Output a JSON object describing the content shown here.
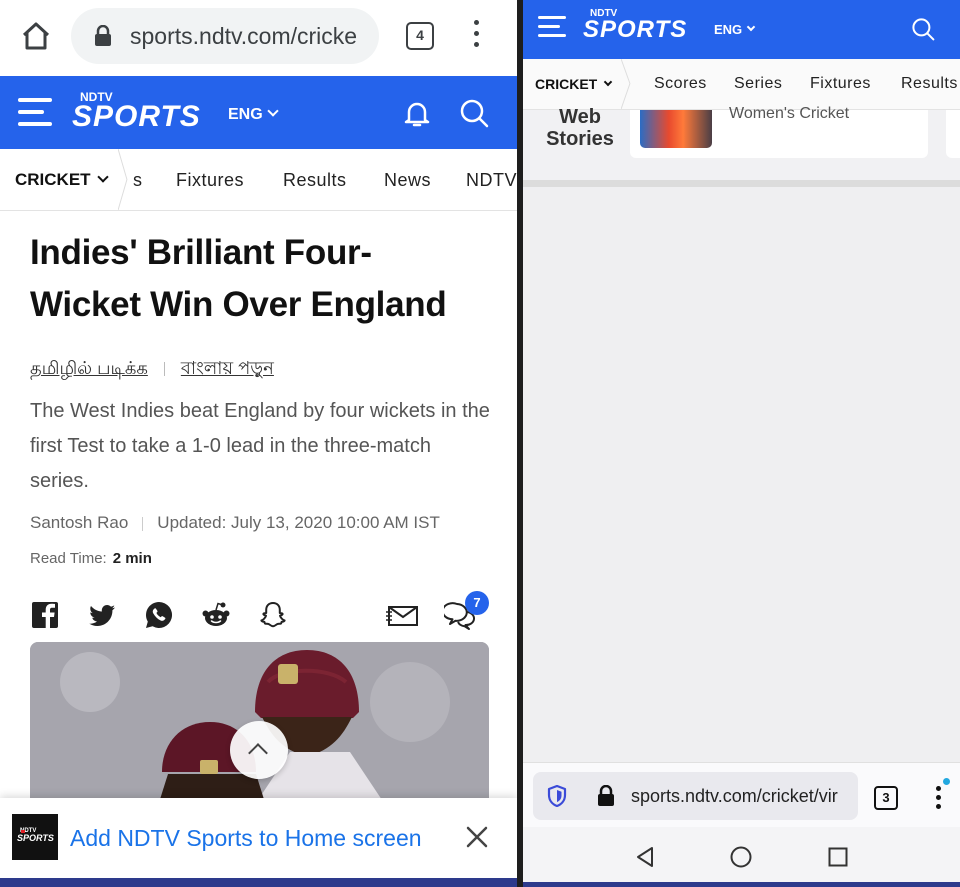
{
  "left": {
    "browser": {
      "url": "sports.ndtv.com/cricke",
      "tab_count": "4"
    },
    "header": {
      "logo_ndtv": "NDTV",
      "logo_sports": "SPORTS",
      "language": "ENG"
    },
    "subnav": {
      "category": "CRICKET",
      "items": [
        "s",
        "Fixtures",
        "Results",
        "News",
        "NDTV"
      ]
    },
    "article": {
      "headline_line1": "Indies' Brilliant Four-",
      "headline_line2": "Wicket Win Over England",
      "lang_tamil": "தமிழில் படிக்க",
      "lang_bengali": "বাংলায় পড়ুন",
      "summary": "The West Indies beat England by four wickets in the first Test to take a 1-0 lead in the three-match series.",
      "author": "Santosh Rao",
      "updated": "Updated: July 13, 2020 10:00 AM IST",
      "read_time_label": "Read Time:",
      "read_time_value": "2 min",
      "comment_count": "7"
    },
    "add_to_home": {
      "label": "Add NDTV Sports to Home screen",
      "icon_text": "NDTV SPORTS"
    }
  },
  "right": {
    "header": {
      "logo_ndtv": "NDTV",
      "logo_sports": "SPORTS",
      "language": "ENG"
    },
    "subnav": {
      "category": "CRICKET",
      "items": [
        "Scores",
        "Series",
        "Fixtures",
        "Results"
      ]
    },
    "web_stories": {
      "label": "Web Stories",
      "card_title": "Women's Cricket"
    },
    "browser": {
      "url": "sports.ndtv.com/cricket/vir",
      "tab_count": "3"
    }
  },
  "colors": {
    "ndtv_blue": "#2563eb",
    "link_blue": "#1a73e8",
    "badge_blue": "#2563eb"
  }
}
